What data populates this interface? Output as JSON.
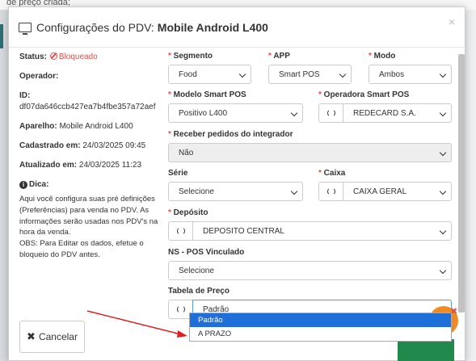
{
  "background": {
    "top_text": "de preço criada;"
  },
  "modal": {
    "title_prefix": "Configurações do PDV:",
    "title_device": "Mobile Android L400",
    "close": "×"
  },
  "info": {
    "status_label": "Status:",
    "status_value": "Bloqueado",
    "operador_label": "Operador:",
    "id_label": "ID:",
    "id_value": "df07da646ccb427ea7b4fbe357a72aef",
    "aparelho_label": "Aparelho:",
    "aparelho_value": "Mobile Android L400",
    "cadastrado_label": "Cadastrado em:",
    "cadastrado_value": "24/03/2025 09:45",
    "atualizado_label": "Atualizado em:",
    "atualizado_value": "24/03/2025 11:23",
    "dica_label": "Dica:",
    "dica_text1": "Aqui você configura suas pré definições (Preferências) para venda no PDV. As informações serão usadas nos PDV's na hora da venda.",
    "dica_text2": "OBS: Para Editar os dados, efetue o bloqueio do PDV antes."
  },
  "form": {
    "segmento": {
      "label": "Segmento",
      "value": "Food"
    },
    "app": {
      "label": "APP",
      "value": "Smart POS"
    },
    "modo": {
      "label": "Modo",
      "value": "Ambos"
    },
    "modelo": {
      "label": "Modelo Smart POS",
      "value": "Positivo L400"
    },
    "operadora": {
      "label": "Operadora Smart POS",
      "value": "REDECARD S.A."
    },
    "receber": {
      "label": "Receber pedidos do integrador",
      "value": "Não"
    },
    "serie": {
      "label": "Série",
      "value": "Selecione"
    },
    "caixa": {
      "label": "Caixa",
      "value": "CAIXA GERAL"
    },
    "deposito": {
      "label": "Depósito",
      "value": "DEPOSITO CENTRAL"
    },
    "ns": {
      "label": "NS - POS Vinculado",
      "value": "Selecione"
    },
    "tabela": {
      "label": "Tabela de Preço",
      "value": "Padrão"
    }
  },
  "dropdown": {
    "options": [
      "Padrão",
      "A PRAZO"
    ],
    "highlighted": "Padrão"
  },
  "buttons": {
    "cancel": "Cancelar"
  },
  "colors": {
    "required": "#d9534f",
    "highlight": "#1e6fd9",
    "arrow": "#e02020"
  }
}
